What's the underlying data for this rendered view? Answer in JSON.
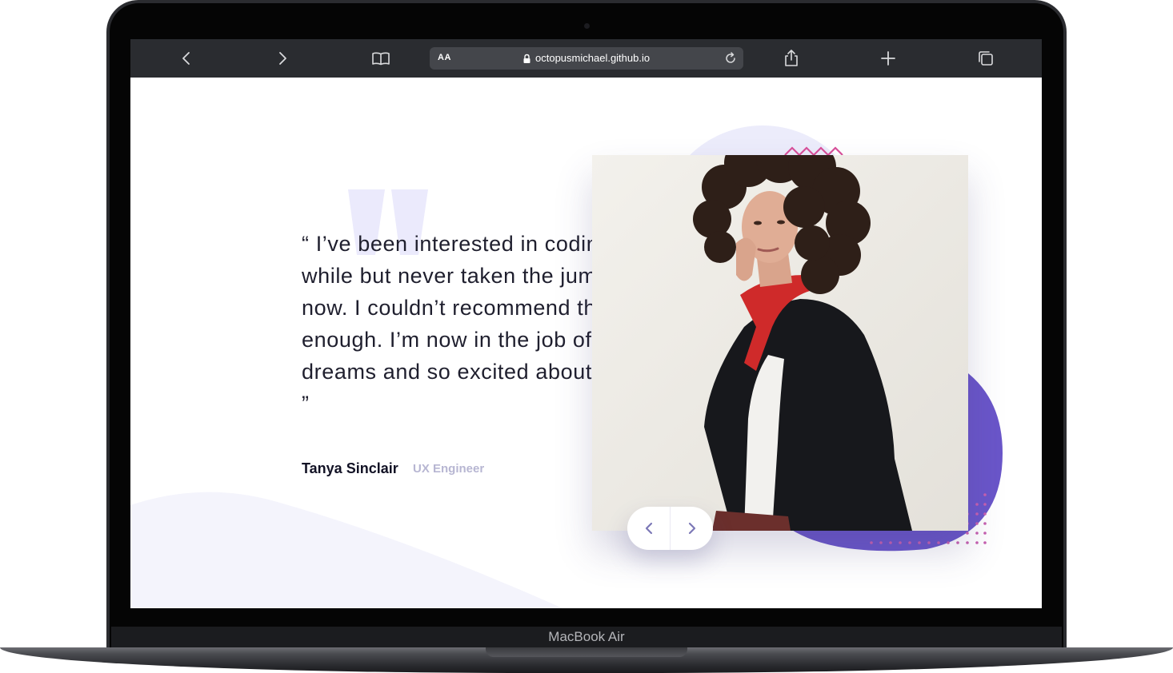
{
  "device": {
    "model_label": "MacBook Air"
  },
  "browser": {
    "text_size_label": "AA",
    "url": "octopusmichael.github.io",
    "buttons": {
      "back": "chevron-left-icon",
      "forward": "chevron-right-icon",
      "bookmarks": "book-icon",
      "reload": "reload-icon",
      "share": "share-icon",
      "new_tab": "plus-icon",
      "tabs": "tabs-icon"
    }
  },
  "testimonial": {
    "quote": "“ I’ve been interested in coding for a while but never taken the jump, until now. I couldn’t recommend this course enough. I’m now in the job of my dreams and so excited about the future. ”",
    "author_name": "Tanya Sinclair",
    "author_role": "UX Engineer",
    "photo_subject": "portrait of woman with curly hair, black coat and red scarf",
    "nav": {
      "prev_icon": "chevron-left-icon",
      "next_icon": "chevron-right-icon"
    }
  },
  "colors": {
    "accent_purple": "#6a56c9",
    "author_role": "#b7b6d2",
    "pattern_pink": "#d9509a",
    "quote_mark": "#ebeafc"
  }
}
